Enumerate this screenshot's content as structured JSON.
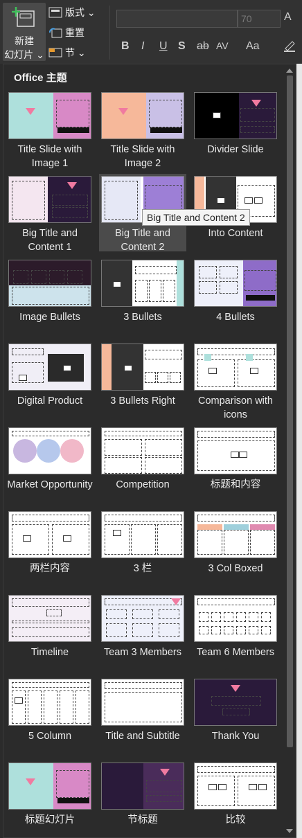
{
  "ribbon": {
    "new_slide_line1": "新建",
    "new_slide_line2": "幻灯片 ⌄",
    "layout_label": "版式 ⌄",
    "reset_label": "重置",
    "section_label": "节 ⌄",
    "font_size": "70",
    "bold": "B",
    "italic": "I",
    "underline": "U",
    "shadow": "S",
    "strike": "ab",
    "spacing": "AV",
    "case": "Aa",
    "grow": "A"
  },
  "gallery": {
    "title": "Office 主题",
    "tooltip": "Big Title and Content 2",
    "layouts": [
      {
        "name": "Title Slide with Image 1",
        "theme": "ts1"
      },
      {
        "name": "Title Slide with Image 2",
        "theme": "ts2"
      },
      {
        "name": "Divider Slide",
        "theme": "div"
      },
      {
        "name": "Big Title and Content 1",
        "theme": "btc1"
      },
      {
        "name": "Big Title and Content 2",
        "theme": "btc2"
      },
      {
        "name": "Into Content",
        "theme": "into"
      },
      {
        "name": "Image Bullets",
        "theme": "imgb"
      },
      {
        "name": "3 Bullets",
        "theme": "b3"
      },
      {
        "name": "4 Bullets",
        "theme": "b4"
      },
      {
        "name": "Digital Product",
        "theme": "dig"
      },
      {
        "name": "3 Bullets Right",
        "theme": "b3r"
      },
      {
        "name": "Comparison with icons",
        "theme": "cmpi"
      },
      {
        "name": "Market Opportunity",
        "theme": "mkt"
      },
      {
        "name": "Competition",
        "theme": "comp"
      },
      {
        "name": "标题和内容",
        "theme": "tc"
      },
      {
        "name": "两栏内容",
        "theme": "two"
      },
      {
        "name": "3 栏",
        "theme": "c3"
      },
      {
        "name": "3 Col Boxed",
        "theme": "c3b"
      },
      {
        "name": "Timeline",
        "theme": "time"
      },
      {
        "name": "Team 3 Members",
        "theme": "t3"
      },
      {
        "name": "Team 6 Members",
        "theme": "t6"
      },
      {
        "name": "5 Column",
        "theme": "c5"
      },
      {
        "name": "Title and Subtitle",
        "theme": "tas"
      },
      {
        "name": "Thank You",
        "theme": "ty"
      },
      {
        "name": "标题幻灯片",
        "theme": "ts1"
      },
      {
        "name": "节标题",
        "theme": "sec"
      },
      {
        "name": "比较",
        "theme": "cmp"
      }
    ]
  },
  "colors": {
    "ribbon_bg": "#323232",
    "gallery_bg": "#2b2b2b",
    "selected": "#4b4b4b",
    "teal": "#aee0dc",
    "pink": "#d889c6",
    "purple_dark": "#2a1a3a",
    "peach": "#f6b89a",
    "lavender": "#c9c0e6"
  }
}
